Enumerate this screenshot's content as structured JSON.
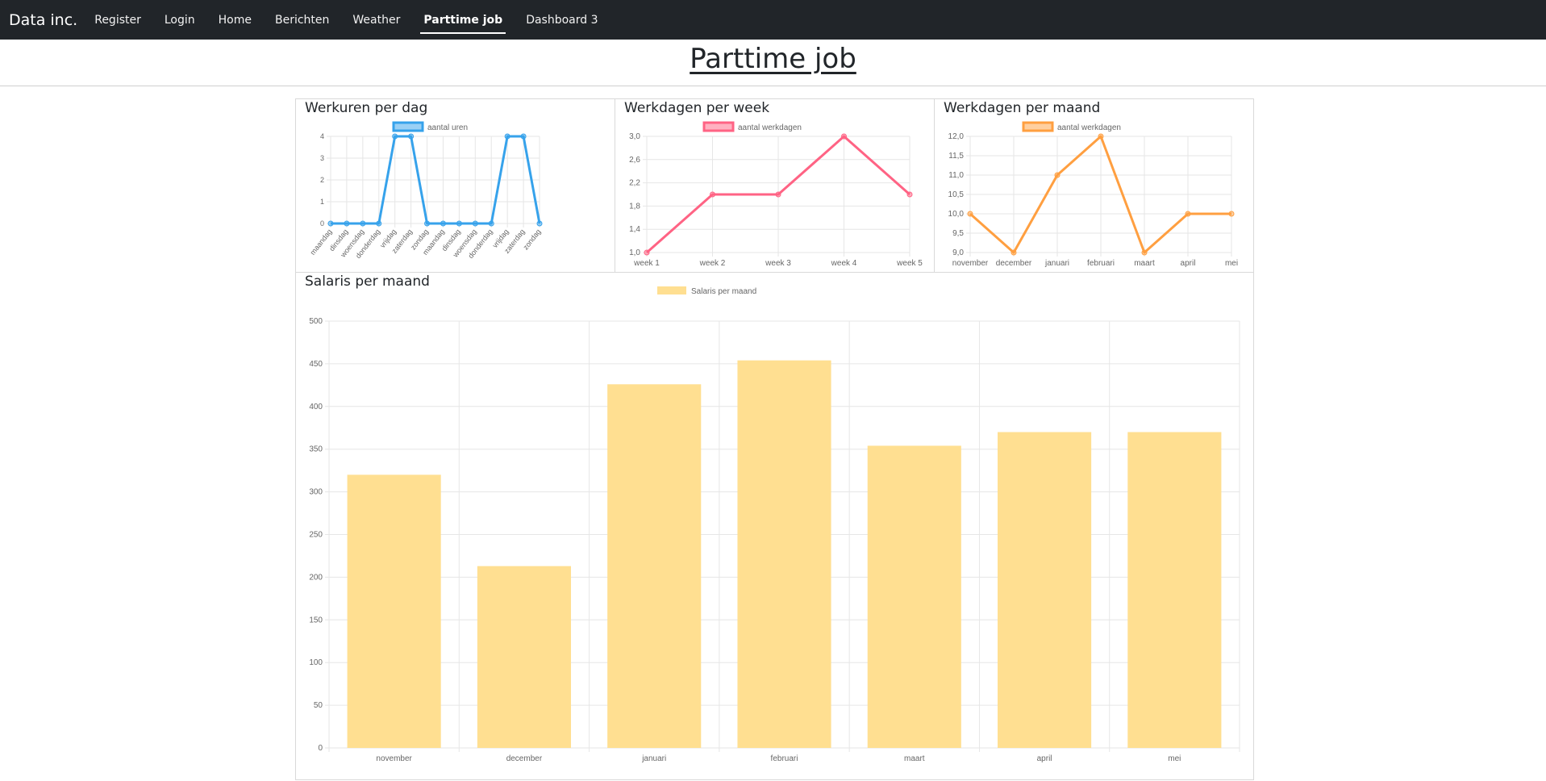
{
  "nav": {
    "brand": "Data inc.",
    "items": [
      {
        "label": "Register",
        "active": false
      },
      {
        "label": "Login",
        "active": false
      },
      {
        "label": "Home",
        "active": false
      },
      {
        "label": "Berichten",
        "active": false
      },
      {
        "label": "Weather",
        "active": false
      },
      {
        "label": "Parttime job",
        "active": true
      },
      {
        "label": "Dashboard 3",
        "active": false
      }
    ]
  },
  "page": {
    "title": "Parttime job"
  },
  "colors": {
    "blue": "#36a2eb",
    "pink": "#ff6384",
    "orange": "#ff9f40",
    "yellow": "#ffdf91",
    "grid": "#e6e6e6",
    "tick_text": "#666666"
  },
  "panels": [
    {
      "title": "Werkuren per dag"
    },
    {
      "title": "Werkdagen per week"
    },
    {
      "title": "Werkdagen per maand"
    },
    {
      "title": "Salaris per maand"
    }
  ],
  "chart_data": [
    {
      "type": "line",
      "title": "Werkuren per dag",
      "categories": [
        "maandag",
        "dinsdag",
        "woensdag",
        "donderdag",
        "vrijdag",
        "zaterdag",
        "zondag",
        "maandag",
        "dinsdag",
        "woensdag",
        "donderdag",
        "vrijdag",
        "zaterdag",
        "zondag"
      ],
      "series": [
        {
          "name": "aantal uren",
          "values": [
            0,
            0,
            0,
            0,
            4,
            4,
            0,
            0,
            0,
            0,
            0,
            4,
            4,
            0
          ]
        }
      ],
      "ylim": [
        0,
        4
      ],
      "yticks": [
        "0",
        "1",
        "2",
        "3",
        "4"
      ],
      "legend": "top",
      "grid": true
    },
    {
      "type": "line",
      "title": "Werkdagen per week",
      "categories": [
        "week 1",
        "week 2",
        "week 3",
        "week 4",
        "week 5"
      ],
      "series": [
        {
          "name": "aantal werkdagen",
          "values": [
            1,
            2,
            2,
            3,
            2
          ]
        }
      ],
      "ylim": [
        1,
        3
      ],
      "yticks": [
        "1,0",
        "1,4",
        "1,8",
        "2,2",
        "2,6",
        "3,0"
      ],
      "legend": "top",
      "grid": true
    },
    {
      "type": "line",
      "title": "Werkdagen per maand",
      "categories": [
        "november",
        "december",
        "januari",
        "februari",
        "maart",
        "april",
        "mei"
      ],
      "series": [
        {
          "name": "aantal werkdagen",
          "values": [
            10,
            9,
            11,
            12,
            9,
            10,
            10
          ]
        }
      ],
      "ylim": [
        9,
        12
      ],
      "yticks": [
        "9,0",
        "9,5",
        "10,0",
        "10,5",
        "11,0",
        "11,5",
        "12,0"
      ],
      "legend": "top",
      "grid": true
    },
    {
      "type": "bar",
      "title": "Salaris per maand",
      "categories": [
        "november",
        "december",
        "januari",
        "februari",
        "maart",
        "april",
        "mei"
      ],
      "series": [
        {
          "name": "Salaris per maand",
          "values": [
            320,
            213,
            426,
            454,
            354,
            370,
            370
          ]
        }
      ],
      "ylim": [
        0,
        500
      ],
      "yticks": [
        "0",
        "50",
        "100",
        "150",
        "200",
        "250",
        "300",
        "350",
        "400",
        "450",
        "500"
      ],
      "legend": "top",
      "grid": true
    }
  ]
}
